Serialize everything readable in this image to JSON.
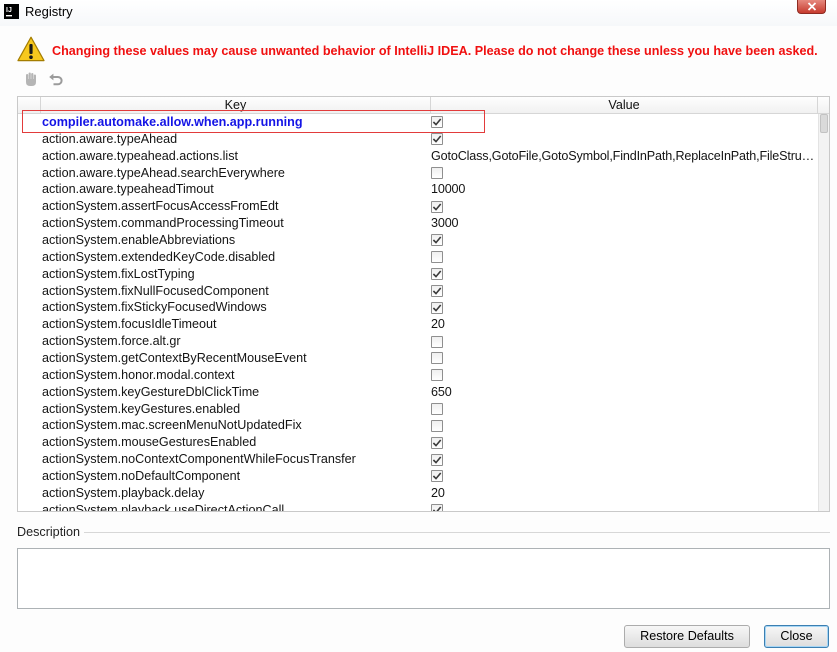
{
  "window": {
    "title": "Registry",
    "logo_text": "IJ",
    "logo_icon": "intellij-logo-icon",
    "close_icon": "close-icon"
  },
  "warning": {
    "icon": "warning-triangle-icon",
    "text": "Changing these values may cause unwanted behavior of IntelliJ IDEA. Please do not change these unless you have been asked."
  },
  "toolbar": {
    "actions": [
      {
        "icon": "hand-icon",
        "enabled": false
      },
      {
        "icon": "undo-icon",
        "enabled": false
      }
    ]
  },
  "table": {
    "columns": {
      "key": "Key",
      "value": "Value"
    },
    "rows": [
      {
        "key": "compiler.automake.allow.when.app.running",
        "checked": true,
        "modified": true
      },
      {
        "key": "action.aware.typeAhead",
        "checked": true
      },
      {
        "key": "action.aware.typeahead.actions.list",
        "value": "GotoClass,GotoFile,GotoSymbol,FindInPath,ReplaceInPath,FileStru…"
      },
      {
        "key": "action.aware.typeAhead.searchEverywhere",
        "checked": false
      },
      {
        "key": "action.aware.typeaheadTimout",
        "value": "10000"
      },
      {
        "key": "actionSystem.assertFocusAccessFromEdt",
        "checked": true
      },
      {
        "key": "actionSystem.commandProcessingTimeout",
        "value": "3000"
      },
      {
        "key": "actionSystem.enableAbbreviations",
        "checked": true
      },
      {
        "key": "actionSystem.extendedKeyCode.disabled",
        "checked": false
      },
      {
        "key": "actionSystem.fixLostTyping",
        "checked": true
      },
      {
        "key": "actionSystem.fixNullFocusedComponent",
        "checked": true
      },
      {
        "key": "actionSystem.fixStickyFocusedWindows",
        "checked": true
      },
      {
        "key": "actionSystem.focusIdleTimeout",
        "value": "20"
      },
      {
        "key": "actionSystem.force.alt.gr",
        "checked": false
      },
      {
        "key": "actionSystem.getContextByRecentMouseEvent",
        "checked": false
      },
      {
        "key": "actionSystem.honor.modal.context",
        "checked": false
      },
      {
        "key": "actionSystem.keyGestureDblClickTime",
        "value": "650"
      },
      {
        "key": "actionSystem.keyGestures.enabled",
        "checked": false
      },
      {
        "key": "actionSystem.mac.screenMenuNotUpdatedFix",
        "checked": false
      },
      {
        "key": "actionSystem.mouseGesturesEnabled",
        "checked": true
      },
      {
        "key": "actionSystem.noContextComponentWhileFocusTransfer",
        "checked": true
      },
      {
        "key": "actionSystem.noDefaultComponent",
        "checked": true
      },
      {
        "key": "actionSystem.playback.delay",
        "value": "20"
      },
      {
        "key": "actionSystem.playback.useDirectActionCall",
        "checked": true
      }
    ]
  },
  "description": {
    "label": "Description"
  },
  "buttons": {
    "restore_defaults": "Restore Defaults",
    "close": "Close"
  },
  "colors": {
    "warning_text": "#f01010",
    "modified_key": "#1414e6",
    "annotation_box": "#e23b3b",
    "default_button_border": "#3c7fb1"
  }
}
